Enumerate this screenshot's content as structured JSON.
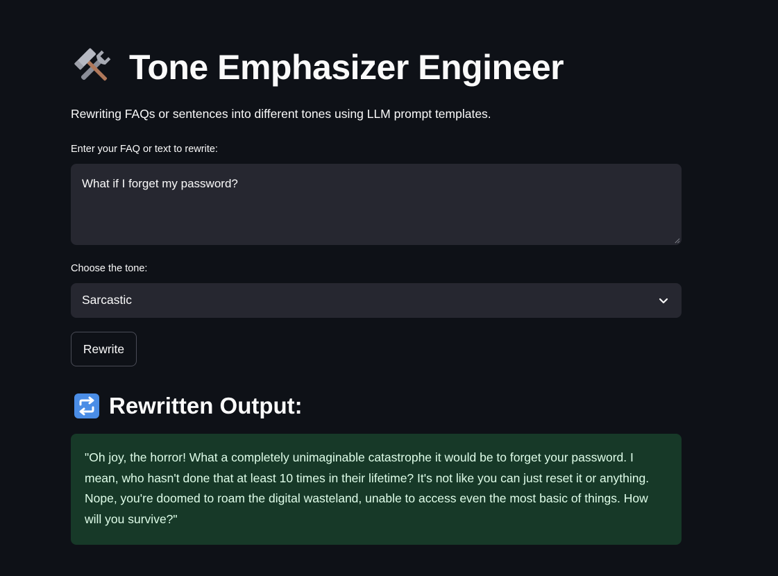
{
  "header": {
    "title": "Tone Emphasizer Engineer",
    "title_icon": "hammer-and-wrench-icon",
    "caption": "Rewriting FAQs or sentences into different tones using LLM prompt templates."
  },
  "form": {
    "text_label": "Enter your FAQ or text to rewrite:",
    "text_value": "What if I forget my password?",
    "tone_label": "Choose the tone:",
    "tone_value": "Sarcastic",
    "button_label": "Rewrite"
  },
  "output": {
    "heading": "Rewritten Output:",
    "heading_icon": "repeat-arrows-icon",
    "text": "\"Oh joy, the horror! What a completely unimaginable catastrophe it would be to forget your password. I mean, who hasn't done that at least 10 times in their lifetime? It's not like you can just reset it or anything. Nope, you're doomed to roam the digital wasteland, unable to access even the most basic of things. How will you survive?\""
  },
  "colors": {
    "background": "#0e1117",
    "input_bg": "#262730",
    "success_bg": "#173928",
    "success_text": "#dffde9",
    "text": "#fafafa"
  }
}
